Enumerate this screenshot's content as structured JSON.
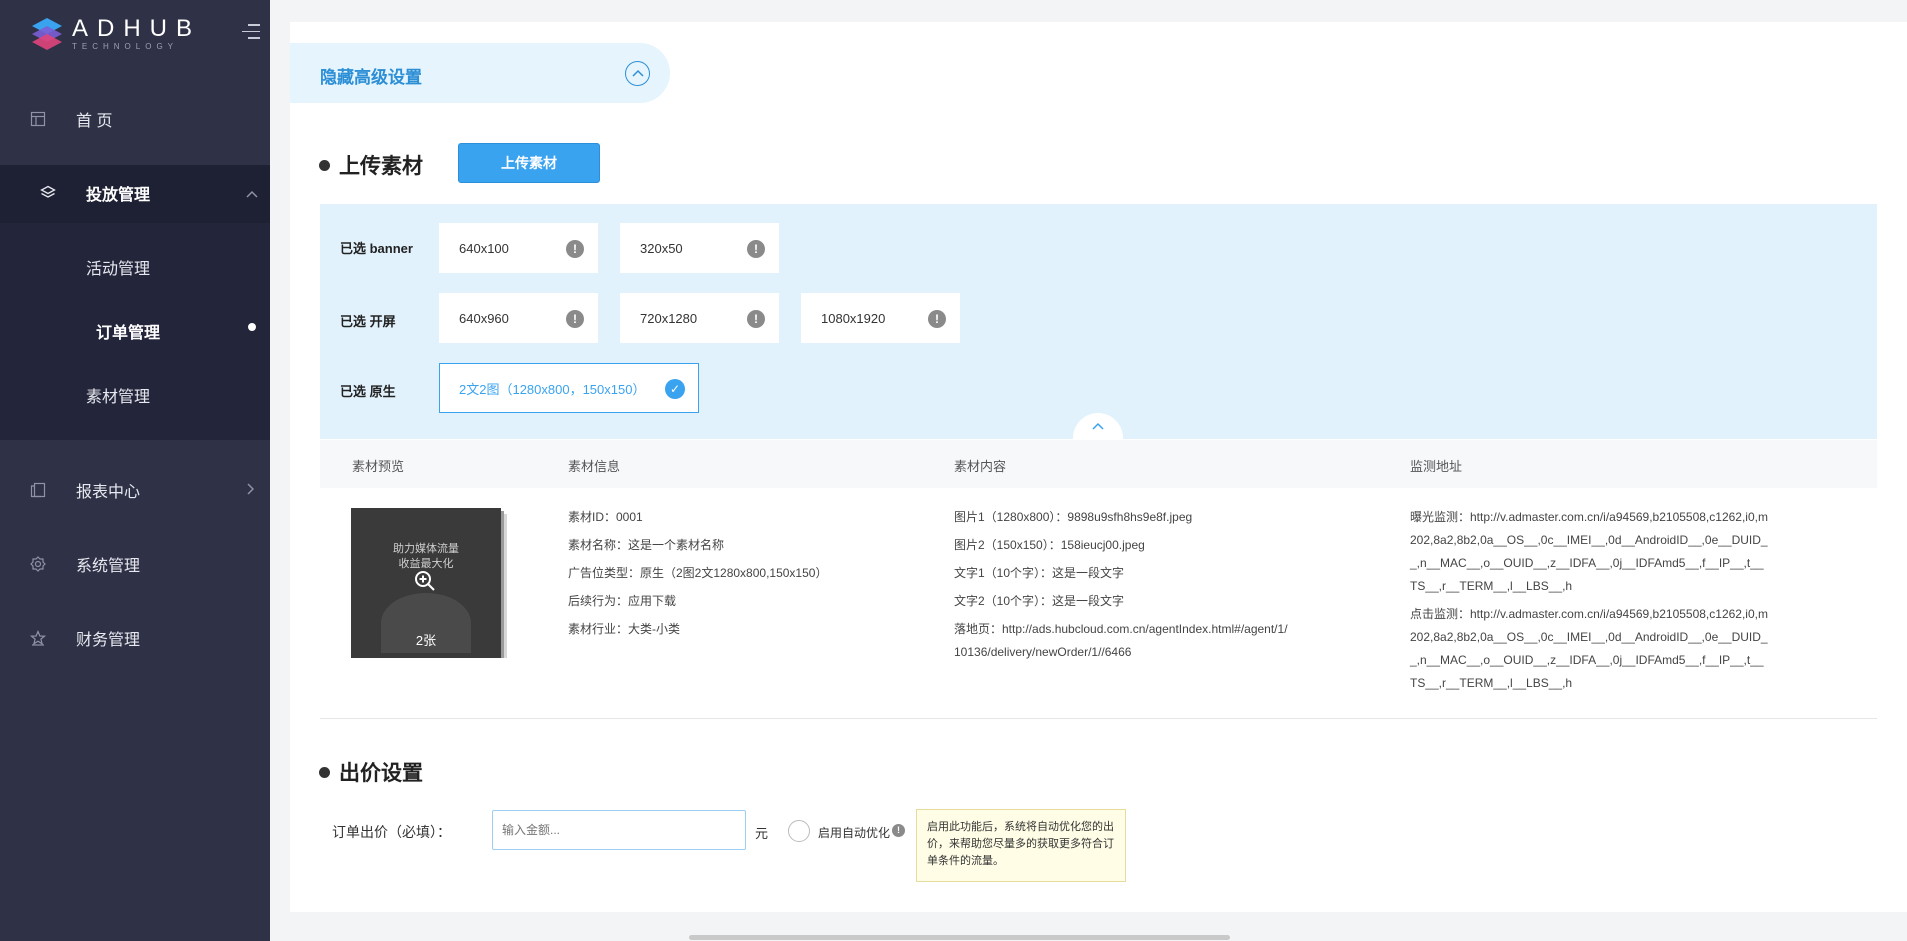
{
  "sidebar": {
    "brand": "ADHUB",
    "brand_sub": "TECHNOLOGY",
    "items": [
      {
        "label": "首 页",
        "icon": "dashboard-icon"
      },
      {
        "label": "投放管理",
        "icon": "layers-icon"
      },
      {
        "label": "报表中心",
        "icon": "report-icon"
      },
      {
        "label": "系统管理",
        "icon": "gear-icon"
      },
      {
        "label": "财务管理",
        "icon": "star-icon"
      }
    ],
    "sub_items": [
      {
        "label": "活动管理"
      },
      {
        "label": "订单管理"
      },
      {
        "label": "素材管理"
      }
    ]
  },
  "advanced": {
    "toggle_label": "隐藏高级设置"
  },
  "upload": {
    "section_title": "上传素材",
    "button_label": "上传素材",
    "rows": [
      {
        "label": "已选 banner",
        "sizes": [
          "640x100",
          "320x50"
        ]
      },
      {
        "label": "已选 开屏",
        "sizes": [
          "640x960",
          "720x1280",
          "1080x1920"
        ]
      },
      {
        "label": "已选 原生",
        "sizes": [
          "2文2图（1280x800，150x150）"
        ]
      }
    ]
  },
  "table": {
    "headers": [
      "素材预览",
      "素材信息",
      "素材内容",
      "监测地址"
    ],
    "preview": {
      "caption_line1": "助力媒体流量",
      "caption_line2": "收益最大化",
      "count": "2张"
    },
    "info": [
      "素材ID：0001",
      "素材名称：这是一个素材名称",
      "广告位类型：原生（2图2文1280x800,150x150）",
      "后续行为：应用下载",
      "素材行业：大类-小类"
    ],
    "content": [
      "图片1（1280x800）：9898u9sfh8hs9e8f.jpeg",
      "图片2（150x150）：158ieucj00.jpeg",
      "文字1（10个字）：这是一段文字",
      "文字2（10个字）：这是一段文字",
      "落地页：http://ads.hubcloud.com.cn/agentIndex.html#/agent/1/10136/delivery/newOrder/1//6466"
    ],
    "monitor": {
      "impression": "曝光监测：http://v.admaster.com.cn/i/a94569,b2105508,c1262,i0,m202,8a2,8b2,0a__OS__,0c__IMEI__,0d__AndroidID__,0e__DUID__,n__MAC__,o__OUID__,z__IDFA__,0j__IDFAmd5__,f__IP__,t__TS__,r__TERM__,l__LBS__,h",
      "click": "点击监测：http://v.admaster.com.cn/i/a94569,b2105508,c1262,i0,m202,8a2,8b2,0a__OS__,0c__IMEI__,0d__AndroidID__,0e__DUID__,n__MAC__,o__OUID__,z__IDFA__,0j__IDFAmd5__,f__IP__,t__TS__,r__TERM__,l__LBS__,h"
    }
  },
  "bid": {
    "section_title": "出价设置",
    "label": "订单出价（必填）：",
    "placeholder": "输入金额...",
    "unit": "元",
    "auto_label": "启用自动优化",
    "tooltip": "启用此功能后，系统将自动优化您的出价，来帮助您尽量多的获取更多符合订单条件的流量。"
  },
  "colors": {
    "sidebar_bg": "#2f3146",
    "accent": "#3aa3f0",
    "panel_bg": "#e1f2fc"
  }
}
